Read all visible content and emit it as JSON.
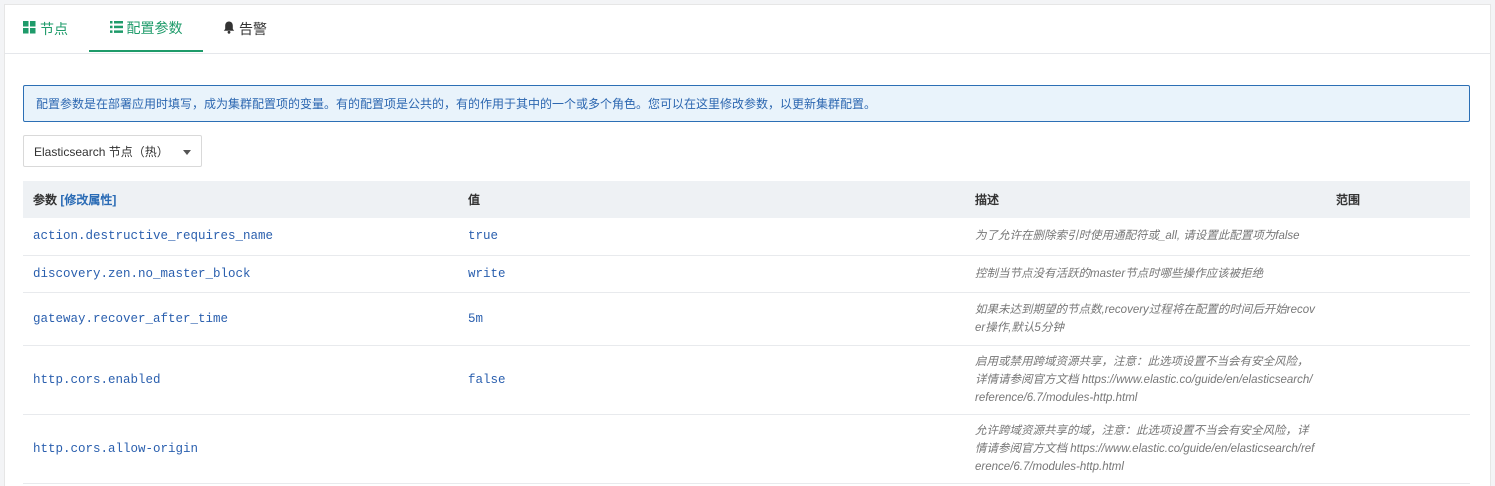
{
  "tabs": [
    {
      "label": "节点",
      "icon": "grid-icon"
    },
    {
      "label": "配置参数",
      "icon": "list-icon"
    },
    {
      "label": "告警",
      "icon": "bell-icon"
    }
  ],
  "alert": {
    "text": "配置参数是在部署应用时填写，成为集群配置项的变量。有的配置项是公共的，有的作用于其中的一个或多个角色。您可以在这里修改参数，以更新集群配置。"
  },
  "role_select": {
    "value": "Elasticsearch 节点（热）"
  },
  "table": {
    "headers": {
      "param": "参数",
      "edit_link": "[修改属性]",
      "value": "值",
      "desc": "描述",
      "scope": "范围"
    },
    "rows": [
      {
        "param": "action.destructive_requires_name",
        "value": "true",
        "desc": "为了允许在删除索引时使用通配符或_all, 请设置此配置项为false",
        "scope": ""
      },
      {
        "param": "discovery.zen.no_master_block",
        "value": "write",
        "desc": "控制当节点没有活跃的master节点时哪些操作应该被拒绝",
        "scope": ""
      },
      {
        "param": "gateway.recover_after_time",
        "value": "5m",
        "desc": "如果未达到期望的节点数,recovery过程将在配置的时间后开始recover操作,默认5分钟",
        "scope": ""
      },
      {
        "param": "http.cors.enabled",
        "value": "false",
        "desc": "启用或禁用跨域资源共享，注意：此选项设置不当会有安全风险，详情请参阅官方文档 https://www.elastic.co/guide/en/elasticsearch/reference/6.7/modules-http.html",
        "scope": ""
      },
      {
        "param": "http.cors.allow-origin",
        "value": "",
        "desc": "允许跨域资源共享的域，注意：此选项设置不当会有安全风险，详情请参阅官方文档 https://www.elastic.co/guide/en/elasticsearch/reference/6.7/modules-http.html",
        "scope": ""
      }
    ]
  },
  "colors": {
    "accent": "#1e9b6a",
    "link": "#2a5fae",
    "alert_border": "#2c6fb5"
  }
}
